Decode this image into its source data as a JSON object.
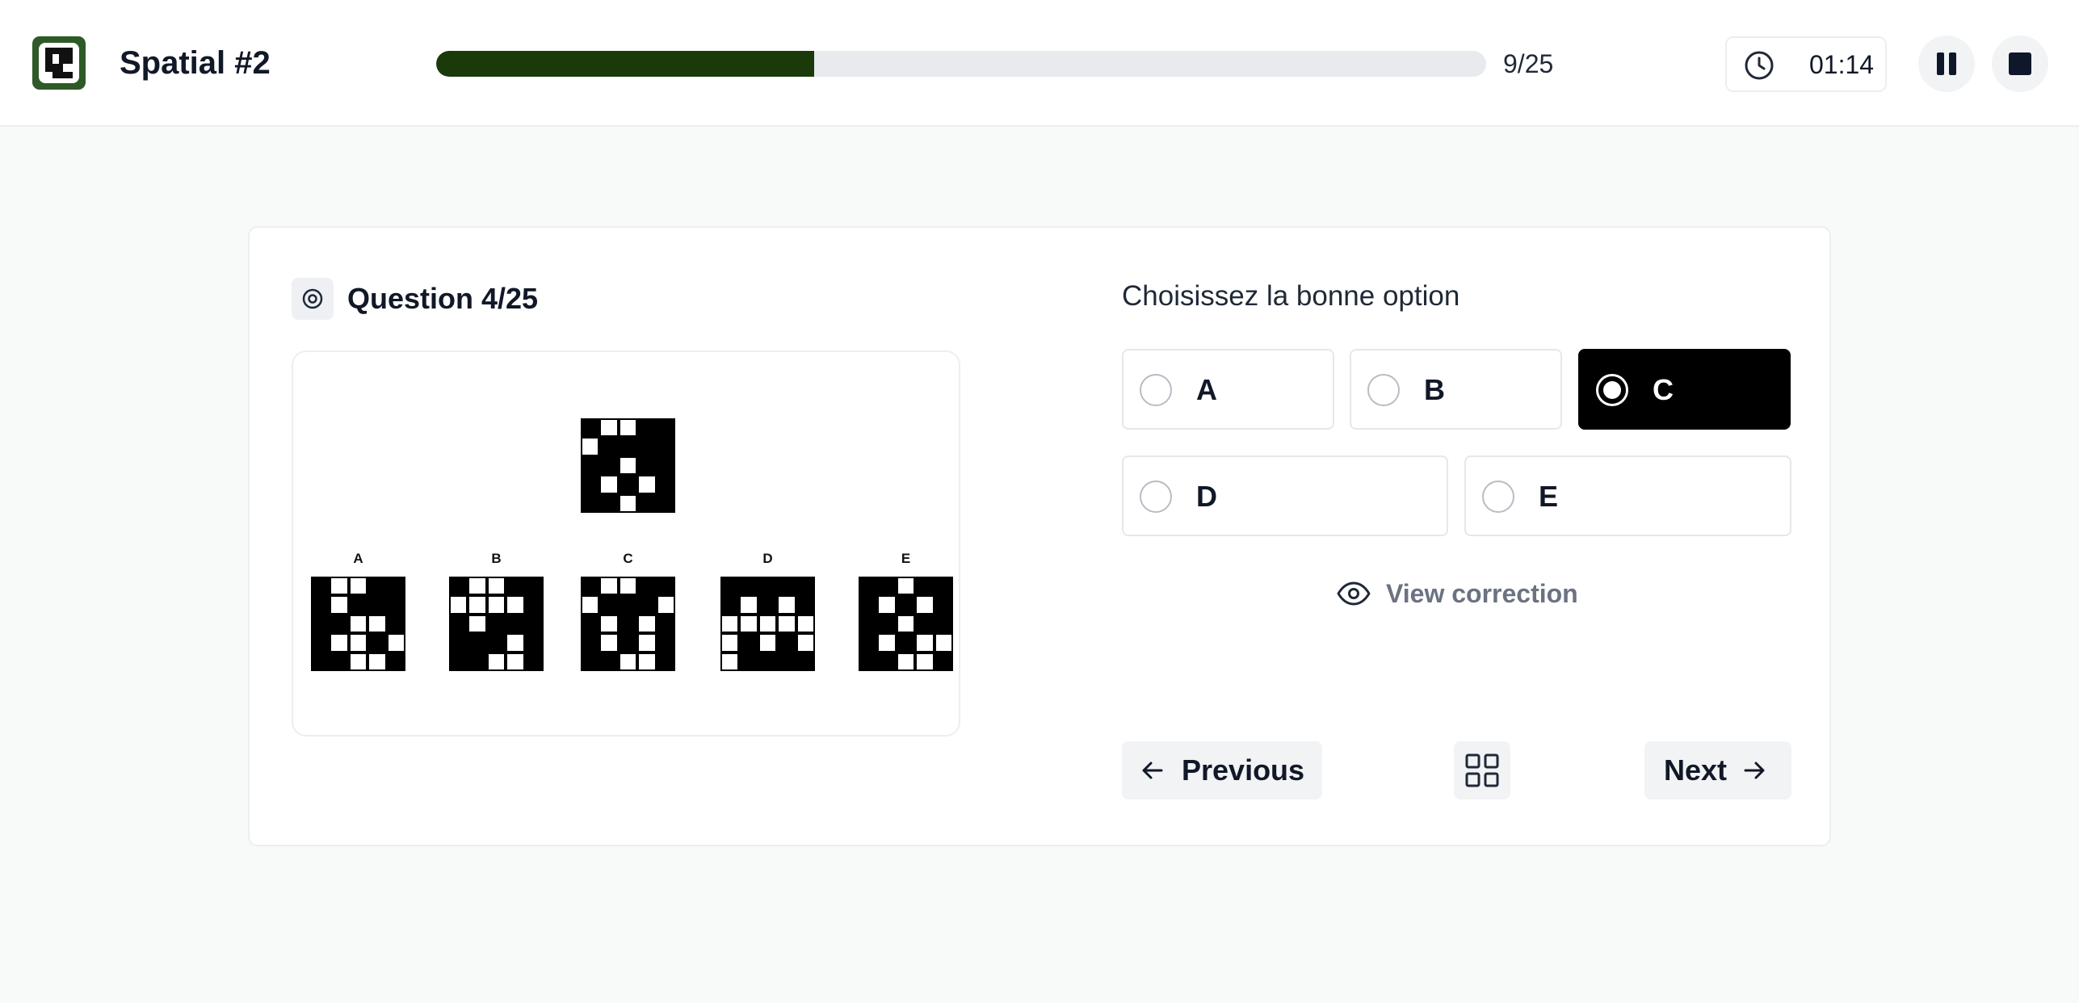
{
  "header": {
    "logo_icon": "puzzle-logo-icon",
    "title": "Spatial #2",
    "progress_fraction": 0.36,
    "progress_text": "9/25",
    "timer_icon": "clock-icon",
    "timer": "01:14",
    "pause_icon": "pause-icon",
    "stop_icon": "stop-icon"
  },
  "question": {
    "icon": "target-icon",
    "title": "Question 4/25",
    "figure": {
      "target": [
        [
          1,
          0,
          0,
          1,
          1
        ],
        [
          0,
          1,
          1,
          1,
          1
        ],
        [
          1,
          1,
          0,
          1,
          1
        ],
        [
          1,
          0,
          1,
          0,
          1
        ],
        [
          1,
          1,
          0,
          1,
          1
        ]
      ],
      "options": [
        {
          "label": "A",
          "pattern": [
            [
              1,
              0,
              0,
              1,
              1
            ],
            [
              1,
              0,
              1,
              1,
              1
            ],
            [
              1,
              1,
              0,
              0,
              1
            ],
            [
              1,
              0,
              0,
              1,
              0
            ],
            [
              1,
              1,
              0,
              0,
              1
            ]
          ]
        },
        {
          "label": "B",
          "pattern": [
            [
              1,
              0,
              0,
              1,
              1
            ],
            [
              0,
              0,
              0,
              0,
              1
            ],
            [
              1,
              0,
              1,
              1,
              1
            ],
            [
              1,
              1,
              1,
              0,
              1
            ],
            [
              1,
              1,
              0,
              0,
              1
            ]
          ]
        },
        {
          "label": "C",
          "pattern": [
            [
              1,
              0,
              0,
              1,
              1
            ],
            [
              0,
              1,
              1,
              1,
              0
            ],
            [
              1,
              0,
              1,
              0,
              1
            ],
            [
              1,
              0,
              1,
              0,
              1
            ],
            [
              1,
              1,
              0,
              0,
              1
            ]
          ]
        },
        {
          "label": "D",
          "pattern": [
            [
              1,
              1,
              1,
              1,
              1
            ],
            [
              1,
              0,
              1,
              0,
              1
            ],
            [
              0,
              0,
              0,
              0,
              0
            ],
            [
              0,
              1,
              0,
              1,
              0
            ],
            [
              0,
              1,
              1,
              1,
              1
            ]
          ]
        },
        {
          "label": "E",
          "pattern": [
            [
              1,
              1,
              0,
              1,
              1
            ],
            [
              1,
              0,
              1,
              0,
              1
            ],
            [
              1,
              1,
              0,
              1,
              1
            ],
            [
              1,
              0,
              1,
              0,
              0
            ],
            [
              1,
              1,
              0,
              0,
              1
            ]
          ]
        }
      ]
    }
  },
  "answer": {
    "prompt": "Choisissez la bonne option",
    "options": [
      "A",
      "B",
      "C",
      "D",
      "E"
    ],
    "selected": "C",
    "view_correction": "View correction",
    "view_correction_icon": "eye-icon"
  },
  "navigation": {
    "previous": "Previous",
    "previous_icon": "arrow-left-icon",
    "overview_icon": "grid-icon",
    "next": "Next",
    "next_icon": "arrow-right-icon"
  }
}
